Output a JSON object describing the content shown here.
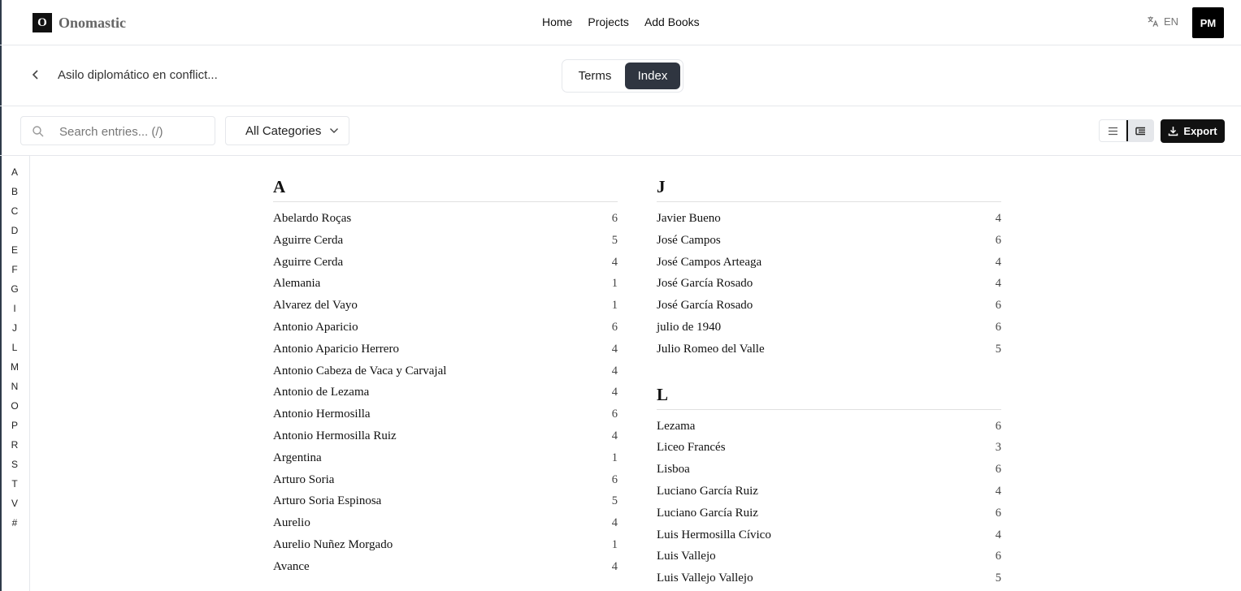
{
  "brand": {
    "logo_letter": "O",
    "name": "Onomastic"
  },
  "nav": {
    "links": [
      "Home",
      "Projects",
      "Add Books"
    ],
    "language": "EN",
    "avatar_initials": "PM"
  },
  "header": {
    "book_title": "Asilo diplomático en conflict...",
    "tabs": [
      "Terms",
      "Index"
    ],
    "active_tab": "Index"
  },
  "toolbar": {
    "search_placeholder": "Search entries... (/)",
    "category": "All Categories",
    "export_label": "Export"
  },
  "alphabet": [
    "A",
    "B",
    "C",
    "D",
    "E",
    "F",
    "G",
    "I",
    "J",
    "L",
    "M",
    "N",
    "O",
    "P",
    "R",
    "S",
    "T",
    "V",
    "#"
  ],
  "sections_left": [
    {
      "letter": "A",
      "entries": [
        {
          "name": "Abelardo Roças",
          "count": "6"
        },
        {
          "name": "Aguirre Cerda",
          "count": "5"
        },
        {
          "name": "Aguirre Cerda",
          "count": "4"
        },
        {
          "name": "Alemania",
          "count": "1"
        },
        {
          "name": "Alvarez del Vayo",
          "count": "1"
        },
        {
          "name": "Antonio Aparicio",
          "count": "6"
        },
        {
          "name": "Antonio Aparicio Herrero",
          "count": "4"
        },
        {
          "name": "Antonio Cabeza de Vaca y Carvajal",
          "count": "4"
        },
        {
          "name": "Antonio de Lezama",
          "count": "4"
        },
        {
          "name": "Antonio Hermosilla",
          "count": "6"
        },
        {
          "name": "Antonio Hermosilla Ruiz",
          "count": "4"
        },
        {
          "name": "Argentina",
          "count": "1"
        },
        {
          "name": "Arturo Soria",
          "count": "6"
        },
        {
          "name": "Arturo Soria Espinosa",
          "count": "5"
        },
        {
          "name": "Aurelio",
          "count": "4"
        },
        {
          "name": "Aurelio Nuñez Morgado",
          "count": "1"
        },
        {
          "name": "Avance",
          "count": "4"
        }
      ]
    }
  ],
  "sections_right": [
    {
      "letter": "J",
      "entries": [
        {
          "name": "Javier Bueno",
          "count": "4"
        },
        {
          "name": "José Campos",
          "count": "6"
        },
        {
          "name": "José Campos Arteaga",
          "count": "4"
        },
        {
          "name": "José García Rosado",
          "count": "4"
        },
        {
          "name": "José García Rosado",
          "count": "6"
        },
        {
          "name": "julio de 1940",
          "count": "6"
        },
        {
          "name": "Julio Romeo del Valle",
          "count": "5"
        }
      ]
    },
    {
      "letter": "L",
      "entries": [
        {
          "name": "Lezama",
          "count": "6"
        },
        {
          "name": "Liceo Francés",
          "count": "3"
        },
        {
          "name": "Lisboa",
          "count": "6"
        },
        {
          "name": "Luciano García Ruiz",
          "count": "4"
        },
        {
          "name": "Luciano García Ruiz",
          "count": "6"
        },
        {
          "name": "Luis Hermosilla Cívico",
          "count": "4"
        },
        {
          "name": "Luis Vallejo",
          "count": "6"
        },
        {
          "name": "Luis Vallejo Vallejo",
          "count": "5"
        }
      ]
    }
  ]
}
